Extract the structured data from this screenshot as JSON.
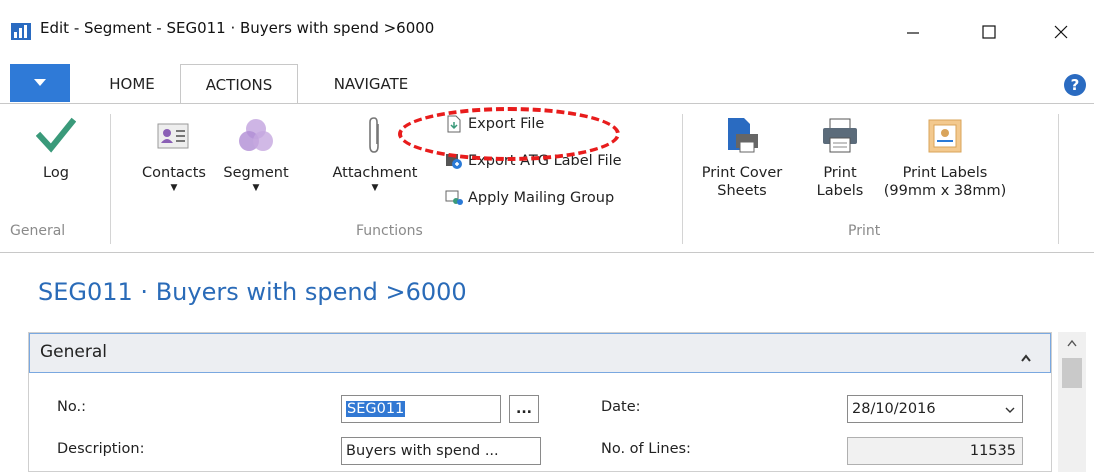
{
  "window": {
    "title": "Edit - Segment - SEG011 · Buyers with spend >6000",
    "minimize_glyph": "—",
    "maximize_glyph": "☐",
    "close_glyph": "✕"
  },
  "ribbon_tabs": {
    "file_icon": "dropdown-triangle-icon",
    "home": "HOME",
    "actions": "ACTIONS",
    "navigate": "NAVIGATE",
    "help": "?"
  },
  "ribbon": {
    "general": {
      "log": "Log",
      "group_label": "General"
    },
    "functions": {
      "contacts": "Contacts",
      "segment": "Segment",
      "attachment": "Attachment",
      "export_file": "Export File",
      "export_atg": "Export ATG Label File",
      "apply_mailing_group": "Apply Mailing Group",
      "group_label": "Functions"
    },
    "print": {
      "print_cover_sheets_line1": "Print Cover",
      "print_cover_sheets_line2": "Sheets",
      "print_labels_line1": "Print",
      "print_labels_line2": "Labels",
      "print_labels_99_line1": "Print Labels",
      "print_labels_99_line2": "(99mm x 38mm)",
      "group_label": "Print"
    }
  },
  "page": {
    "title": "SEG011 · Buyers with spend >6000"
  },
  "general_fasttab": {
    "title": "General",
    "no_label": "No.:",
    "no_value": "SEG011",
    "lookup_label": "...",
    "description_label": "Description:",
    "description_value": "Buyers with spend ...",
    "date_label": "Date:",
    "date_value": "28/10/2016",
    "no_of_lines_label": "No. of Lines:",
    "no_of_lines_value": "11535"
  },
  "colors": {
    "accent_blue": "#2f7ad7",
    "title_blue": "#2a6bb8",
    "highlight_red": "#e81c1c",
    "check_green": "#3a9a7a"
  }
}
